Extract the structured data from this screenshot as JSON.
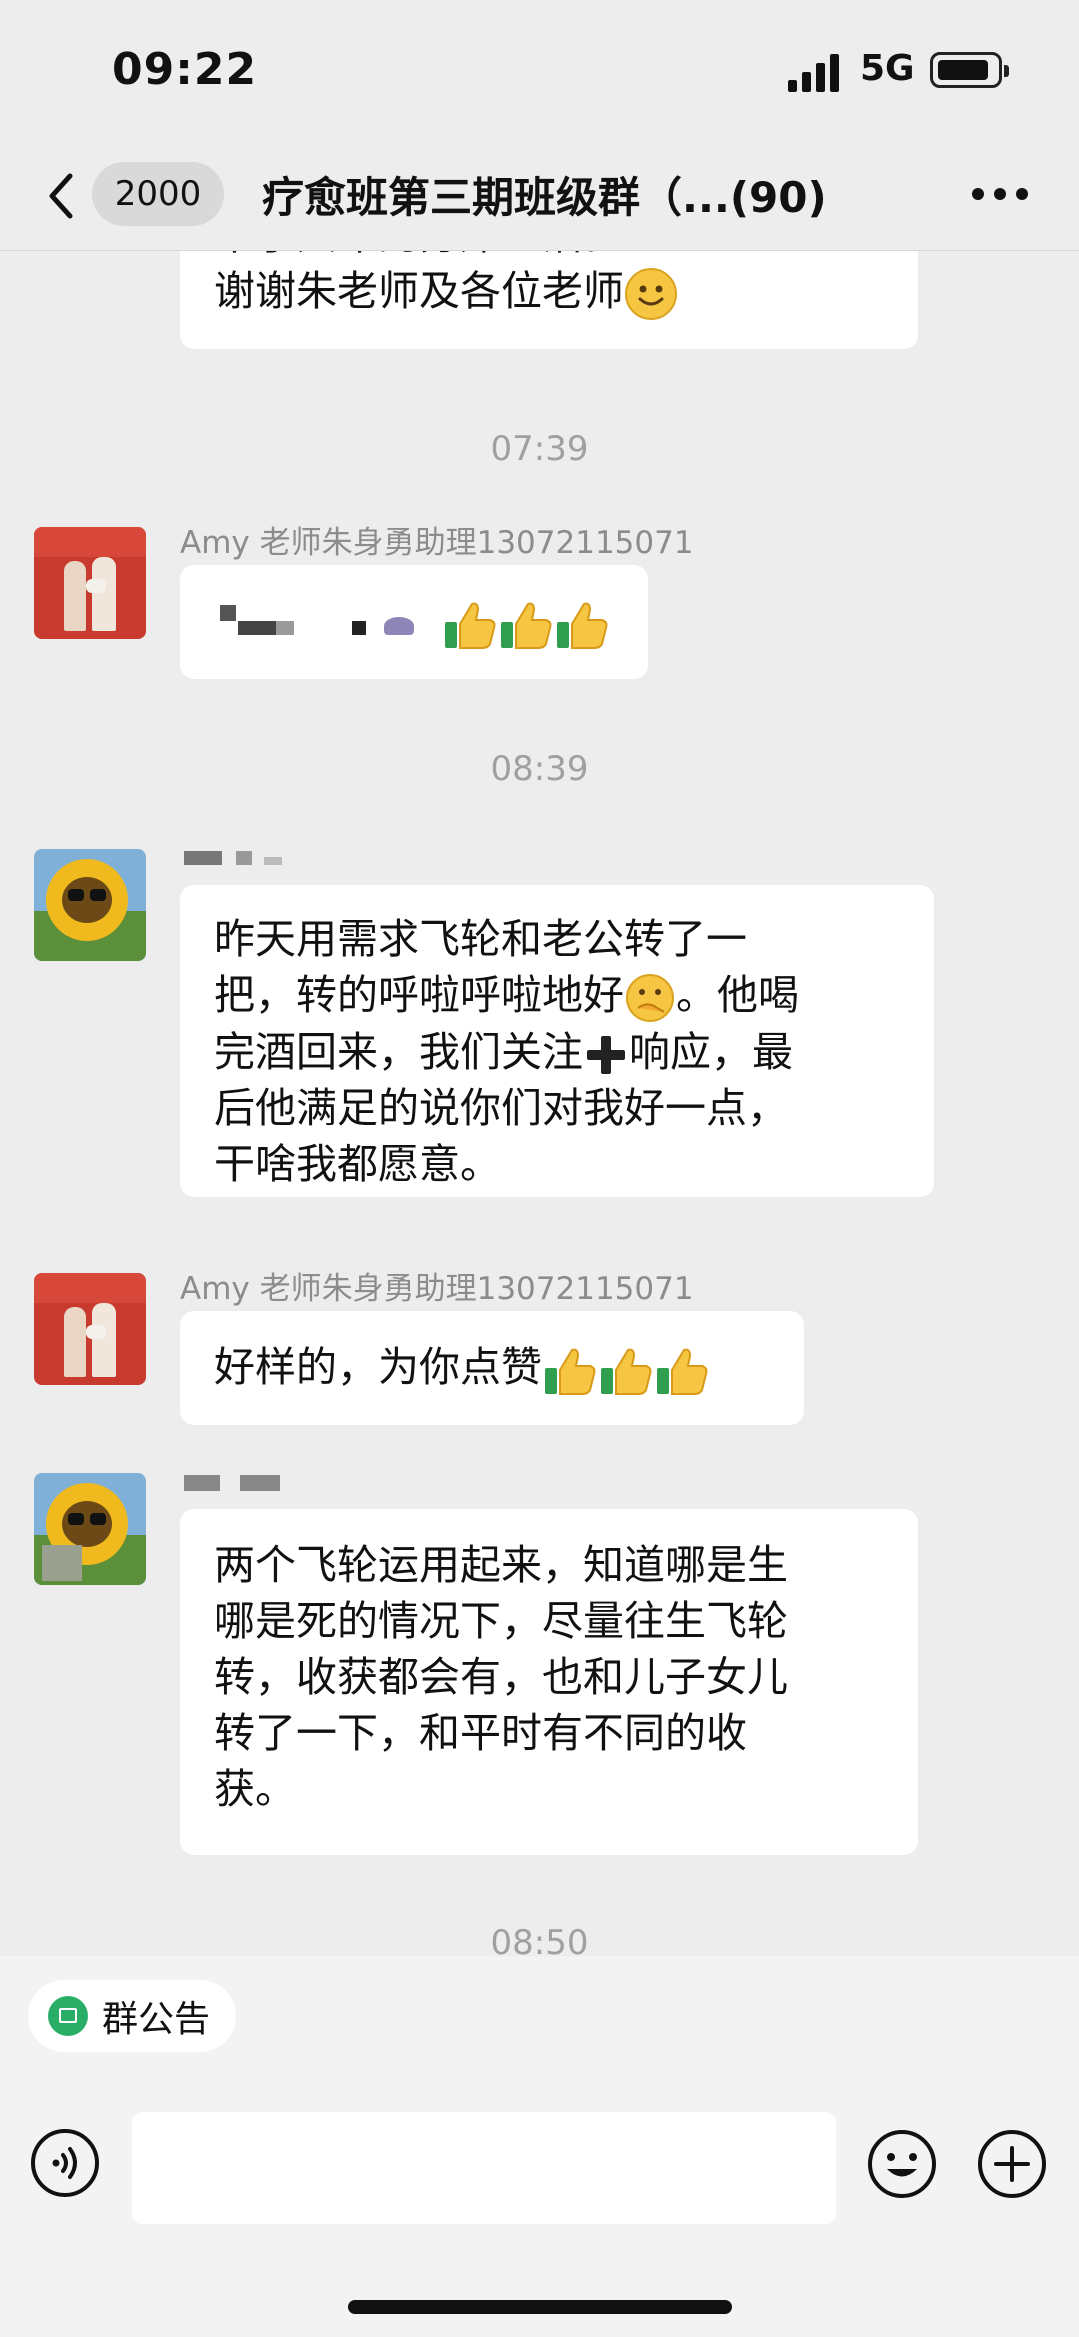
{
  "status": {
    "time": "09:22",
    "network": "5G"
  },
  "nav": {
    "back_count": "2000",
    "title": "疗愈班第三期班级群（...(90)"
  },
  "messages": {
    "m0": {
      "line1": "来了六年的分床生活。",
      "line2": "谢谢朱老师及各位老师"
    },
    "ts1": "07:39",
    "m1": {
      "sender": "Amy 老师朱身勇助理13072115071"
    },
    "ts2": "08:39",
    "m2": {
      "text": [
        "昨天用需求飞轮和老公转了一",
        "把，转的呼啦呼啦地好",
        "完酒回来，我们关注",
        "后他满足的说你们对我好一点，",
        "干啥我都愿意。"
      ],
      "seg_end2": "。他喝",
      "seg_end3": "响应，最"
    },
    "m3": {
      "sender": "Amy 老师朱身勇助理13072115071",
      "text": "好样的，为你点赞"
    },
    "m4": {
      "text": [
        "两个飞轮运用起来，知道哪是生",
        "哪是死的情况下，尽量往生飞轮",
        "转，收获都会有，也和儿子女儿",
        "转了一下，和平时有不同的收",
        "获。"
      ]
    },
    "ts3": "08:50"
  },
  "notice": {
    "label": "群公告"
  },
  "icons": {
    "back": "chevron-left-icon",
    "more": "more-dots-icon",
    "voice": "voice-icon",
    "emoji": "emoji-icon",
    "plus": "plus-icon",
    "thumbs": "thumbs-up-icon",
    "smile": "smile-emoji-icon"
  },
  "colors": {
    "background": "#ededed",
    "bubble": "#ffffff",
    "accent": "#2aae67"
  }
}
